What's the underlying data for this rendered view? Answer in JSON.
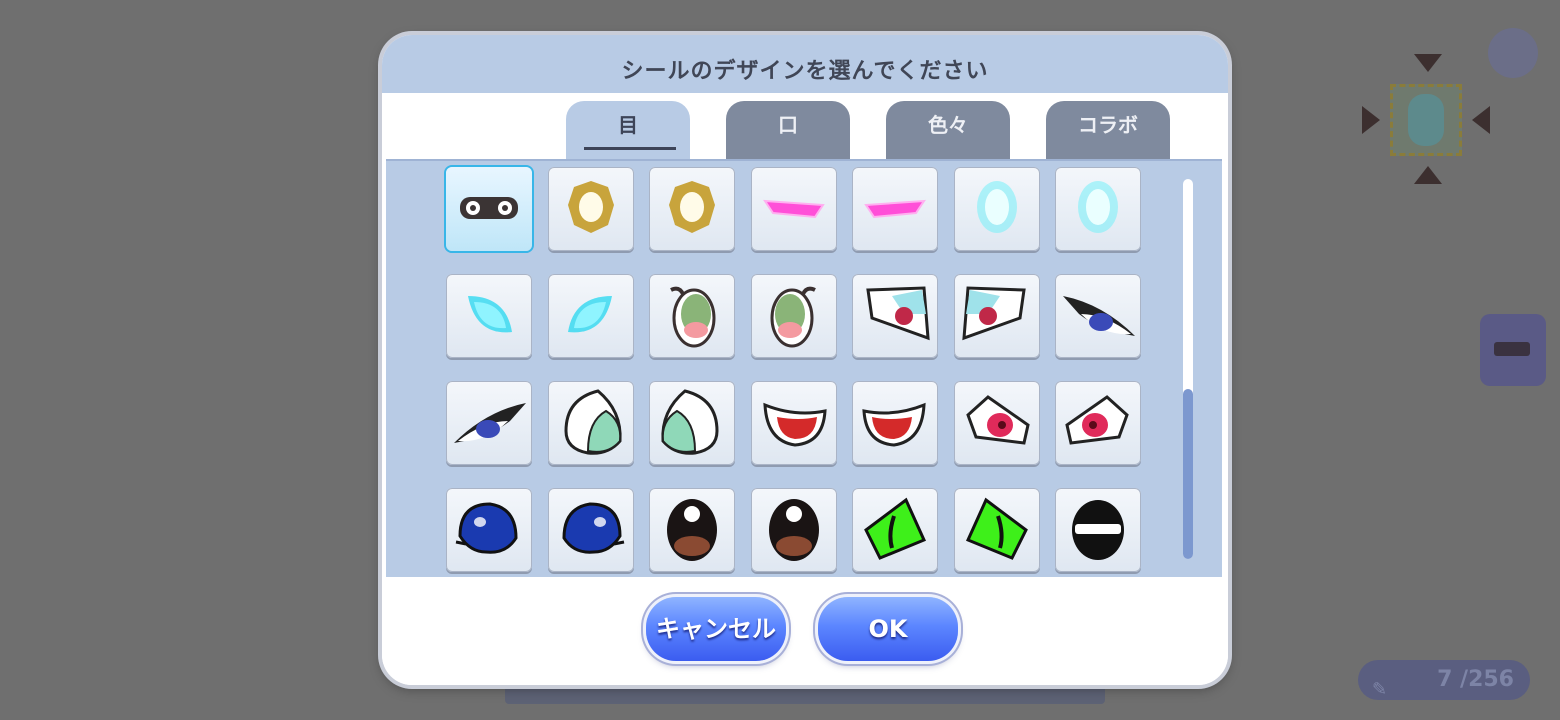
{
  "dialog": {
    "title": "シールのデザインを選んでください",
    "tabs": [
      {
        "label": "目",
        "active": true
      },
      {
        "label": "口",
        "active": false
      },
      {
        "label": "色々",
        "active": false
      },
      {
        "label": "コラボ",
        "active": false
      }
    ],
    "cancel_label": "キャンセル",
    "ok_label": "OK",
    "selected_index": 0
  },
  "stickers": [
    "goggles-eyes",
    "gold-ring-eye-left",
    "gold-ring-eye-right",
    "pink-slit-left",
    "pink-slit-right",
    "cyan-glow-oval-left",
    "cyan-glow-oval-right",
    "cyan-glow-half-left",
    "cyan-glow-half-right",
    "green-cartoon-eye-left",
    "green-cartoon-eye-right",
    "red-sharp-eye-left",
    "red-sharp-eye-right",
    "blue-narrow-eye-right",
    "blue-narrow-eye-left",
    "teal-teardrop-left",
    "teal-teardrop-right",
    "red-angry-eye-left",
    "red-angry-eye-right",
    "red-fierce-eye-left",
    "red-fierce-eye-right",
    "blue-glossy-eye-left",
    "blue-glossy-eye-right",
    "brown-round-eye-left",
    "brown-round-eye-right",
    "green-cat-eye-left",
    "green-cat-eye-right",
    "black-bar-eye"
  ],
  "colors": {
    "header": "#b8cbe5",
    "tab_inactive": "#7f8a9e",
    "button_blue": "#5c86ff",
    "selection": "#38b6e8"
  },
  "background": {
    "counter": "7 /256"
  }
}
